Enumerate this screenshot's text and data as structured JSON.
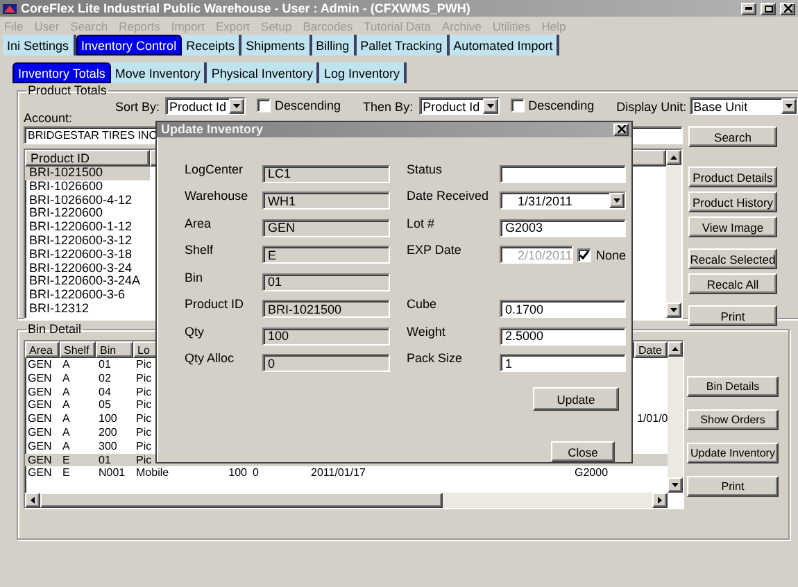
{
  "window": {
    "title": "CoreFlex Lite Industrial Public Warehouse - User : Admin - (CFXWMS_PWH)"
  },
  "menu": [
    "File",
    "User",
    "Search",
    "Reports",
    "Import",
    "Export",
    "Setup",
    "Barcodes",
    "Tutorial Data",
    "Archive",
    "Utilities",
    "Help"
  ],
  "tabs": [
    {
      "label": "Ini Settings",
      "selected": false
    },
    {
      "label": "Inventory Control",
      "selected": true
    },
    {
      "label": "Receipts",
      "selected": false
    },
    {
      "label": "Shipments",
      "selected": false
    },
    {
      "label": "Billing",
      "selected": false
    },
    {
      "label": "Pallet Tracking",
      "selected": false
    },
    {
      "label": "Automated Import",
      "selected": false
    }
  ],
  "subtabs": [
    {
      "label": "Inventory Totals",
      "selected": true
    },
    {
      "label": "Move Inventory",
      "selected": false
    },
    {
      "label": "Physical Inventory",
      "selected": false
    },
    {
      "label": "Log Inventory",
      "selected": false
    }
  ],
  "product_totals": {
    "title": "Product Totals",
    "account": {
      "label": "Account:",
      "value": "BRIDGESTAR TIRES INC"
    },
    "sort_by": {
      "label": "Sort By:",
      "value": "Product Id",
      "descending": {
        "label": "Descending",
        "checked": false
      }
    },
    "then_by": {
      "label": "Then By:",
      "value": "Product Id",
      "descending": {
        "label": "Descending",
        "checked": false
      }
    },
    "display_unit": {
      "label": "Display Unit:",
      "value": "Base Unit"
    },
    "list_header": "Product ID",
    "products": [
      {
        "text": "BRI-1021500",
        "selected": true
      },
      {
        "text": "BRI-1026600",
        "selected": false
      },
      {
        "text": "BRI-1026600-4-12",
        "selected": false
      },
      {
        "text": "BRI-1220600",
        "selected": false
      },
      {
        "text": "BRI-1220600-1-12",
        "selected": false
      },
      {
        "text": "BRI-1220600-3-12",
        "selected": false
      },
      {
        "text": "BRI-1220600-3-18",
        "selected": false
      },
      {
        "text": "BRI-1220600-3-24",
        "selected": false
      },
      {
        "text": "BRI-1220600-3-24A",
        "selected": false
      },
      {
        "text": "BRI-1220600-3-6",
        "selected": false
      },
      {
        "text": "BRI-12312",
        "selected": false
      }
    ],
    "button_groups": [
      [
        "Search"
      ],
      [
        "Product Details",
        "Product History",
        "View Image"
      ],
      [
        "Recalc Selected",
        "Recalc All"
      ],
      [
        "Print"
      ]
    ]
  },
  "bin_detail": {
    "title": "Bin Detail",
    "columns": [
      "Area",
      "Shelf",
      "Bin",
      "Lo",
      null,
      null,
      null,
      null,
      "Date"
    ],
    "rows": [
      {
        "cells": [
          "GEN",
          "A",
          "01",
          "Pic",
          null,
          null,
          null,
          null,
          null
        ],
        "selected": false
      },
      {
        "cells": [
          "GEN",
          "A",
          "02",
          "Pic",
          null,
          null,
          null,
          null,
          null
        ],
        "selected": false
      },
      {
        "cells": [
          "GEN",
          "A",
          "04",
          "Pic",
          null,
          null,
          null,
          null,
          null
        ],
        "selected": false
      },
      {
        "cells": [
          "GEN",
          "A",
          "05",
          "Pic",
          null,
          null,
          null,
          null,
          null
        ],
        "selected": false
      },
      {
        "cells": [
          "GEN",
          "A",
          "100",
          "Pic",
          null,
          null,
          null,
          null,
          "1/01/0"
        ],
        "selected": false
      },
      {
        "cells": [
          "GEN",
          "A",
          "200",
          "Pic",
          null,
          null,
          null,
          null,
          null
        ],
        "selected": false
      },
      {
        "cells": [
          "GEN",
          "A",
          "300",
          "Pic",
          null,
          null,
          null,
          null,
          null
        ],
        "selected": false
      },
      {
        "cells": [
          "GEN",
          "E",
          "01",
          "Pic",
          null,
          null,
          null,
          null,
          null
        ],
        "selected": true
      },
      {
        "cells": [
          "GEN",
          "E",
          "N001",
          "Mobile",
          "100",
          "0",
          "2011/01/17",
          "G2000",
          null
        ],
        "selected": false
      }
    ],
    "buttons": [
      "Bin Details",
      "Show Orders",
      "Update Inventory",
      "Print"
    ]
  },
  "dialog": {
    "title": "Update Inventory",
    "left_fields": [
      {
        "label": "LogCenter",
        "value": "LC1"
      },
      {
        "label": "Warehouse",
        "value": "WH1"
      },
      {
        "label": "Area",
        "value": "GEN"
      },
      {
        "label": "Shelf",
        "value": "E"
      },
      {
        "label": "Bin",
        "value": "01"
      },
      {
        "label": "Product ID",
        "value": "BRI-1021500"
      },
      {
        "label": "Qty",
        "value": "100"
      },
      {
        "label": "Qty Alloc",
        "value": "0"
      }
    ],
    "right_fields_top": [
      {
        "kind": "text",
        "label": "Status"
      },
      {
        "kind": "date",
        "label": "Date Received",
        "value": "1/31/2011",
        "disabled": false
      },
      {
        "kind": "text",
        "label": "Lot #",
        "value": "G2003"
      },
      {
        "kind": "date",
        "label": "EXP Date",
        "value": "2/10/2011",
        "disabled": true,
        "none": {
          "label": "None",
          "checked": true
        }
      }
    ],
    "right_fields_bottom": [
      {
        "kind": "text",
        "label": "Cube",
        "value": "0.1700"
      },
      {
        "kind": "text",
        "label": "Weight",
        "value": "2.5000"
      },
      {
        "kind": "text",
        "label": "Pack Size",
        "value": "1"
      }
    ],
    "update_button": "Update",
    "close_button": "Close"
  }
}
